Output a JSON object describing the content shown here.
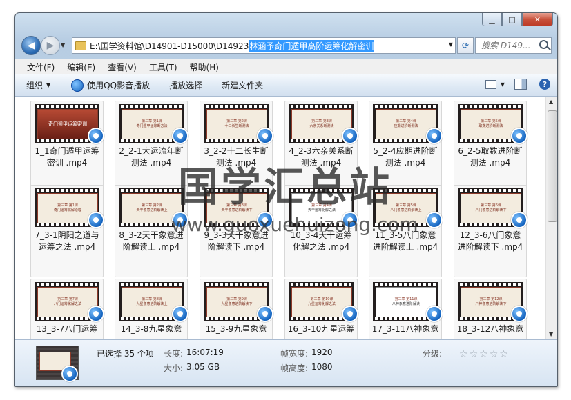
{
  "address": {
    "path": "E:\\国学资料馆\\D14901-D15000\\D14923",
    "selected": "林涵予奇门遁甲高阶运筹化解密训"
  },
  "search": {
    "placeholder": "搜索 D149..."
  },
  "menu": [
    "文件(F)",
    "编辑(E)",
    "查看(V)",
    "工具(T)",
    "帮助(H)"
  ],
  "toolbar": {
    "organize": "组织",
    "qq_play": "使用QQ影音播放",
    "play_selection": "播放选择",
    "new_folder": "新建文件夹"
  },
  "files": [
    {
      "line1": "1_1奇门遁甲运筹",
      "line2": "密训 .mp4",
      "thumb_title": "奇门遁甲运筹密训",
      "thumb_type": "cover"
    },
    {
      "line1": "2_2-1大运流年断",
      "line2": "测法 .mp4",
      "thumb_chapter": "第二章  第1课",
      "thumb_title": "奇门遁甲运筹断方法"
    },
    {
      "line1": "3_2-2十二长生断",
      "line2": "测法 .mp4",
      "thumb_chapter": "第二章  第2课",
      "thumb_title": "十二长生断测法"
    },
    {
      "line1": "4_2-3六亲关系断",
      "line2": "测法 .mp4",
      "thumb_chapter": "第二章  第3课",
      "thumb_title": "六亲关系断测法"
    },
    {
      "line1": "5_2-4应期进阶断",
      "line2": "测法 .mp4",
      "thumb_chapter": "第二章  第4课",
      "thumb_title": "应期进阶断测法"
    },
    {
      "line1": "6_2-5取数进阶断",
      "line2": "测法 .mp4",
      "thumb_chapter": "第二章  第5课",
      "thumb_title": "取数进阶断测法"
    },
    {
      "line1": "7_3-1阴阳之道与",
      "line2": "运筹之法 .mp4",
      "thumb_chapter": "第三章  第1课",
      "thumb_title": "奇门运筹化解原理"
    },
    {
      "line1": "8_3-2天干象意进",
      "line2": "阶解读上 .mp4",
      "thumb_chapter": "第三章  第2课",
      "thumb_title": "天干象意进阶解读上"
    },
    {
      "line1": "9_3-3天干象意进",
      "line2": "阶解读下 .mp4",
      "thumb_chapter": "第三章  第3课",
      "thumb_title": "天干象意进阶解读下"
    },
    {
      "line1": "10_3-4天干运筹",
      "line2": "化解之法 .mp4",
      "thumb_chapter": "第三章  第4课",
      "thumb_title": "天干运筹化解之法",
      "thumb_type": "doc"
    },
    {
      "line1": "11_3-5八门象意",
      "line2": "进阶解读上 .mp4",
      "thumb_chapter": "第三章  第5课",
      "thumb_title": "八门象意进阶解读上"
    },
    {
      "line1": "12_3-6八门象意",
      "line2": "进阶解读下 .mp4",
      "thumb_chapter": "第三章  第6课",
      "thumb_title": "八门象意进阶解读下"
    },
    {
      "line1": "13_3-7八门运筹",
      "line2": "",
      "thumb_chapter": "第三章  第7课",
      "thumb_title": "八门运筹化解之法"
    },
    {
      "line1": "14_3-8九星象意",
      "line2": "",
      "thumb_chapter": "第三章  第8课",
      "thumb_title": "九星象意进阶解读上"
    },
    {
      "line1": "15_3-9九星象意",
      "line2": "",
      "thumb_chapter": "第三章  第9课",
      "thumb_title": "九星象意进阶解读下"
    },
    {
      "line1": "16_3-10九星运筹",
      "line2": "",
      "thumb_chapter": "第三章  第10课",
      "thumb_title": "九星运筹化解之法"
    },
    {
      "line1": "17_3-11八神象意",
      "line2": "",
      "thumb_chapter": "第三章  第11课",
      "thumb_title": "八神象意进阶解读",
      "thumb_type": "doc"
    },
    {
      "line1": "18_3-12八神象意",
      "line2": "",
      "thumb_chapter": "第三章  第12课",
      "thumb_title": "八神象意进阶解读下"
    }
  ],
  "watermark": {
    "title": "国学汇总站",
    "url": "www.guoxuehuizong.com"
  },
  "details": {
    "selected_count": "已选择 35 个项",
    "length_label": "长度:",
    "length_value": "16:07:19",
    "size_label": "大小:",
    "size_value": "3.05 GB",
    "frame_width_label": "帧宽度:",
    "frame_width_value": "1920",
    "frame_height_label": "帧高度:",
    "frame_height_value": "1080",
    "rating_label": "分级:",
    "rating_value": 0,
    "rating_max": 5
  }
}
